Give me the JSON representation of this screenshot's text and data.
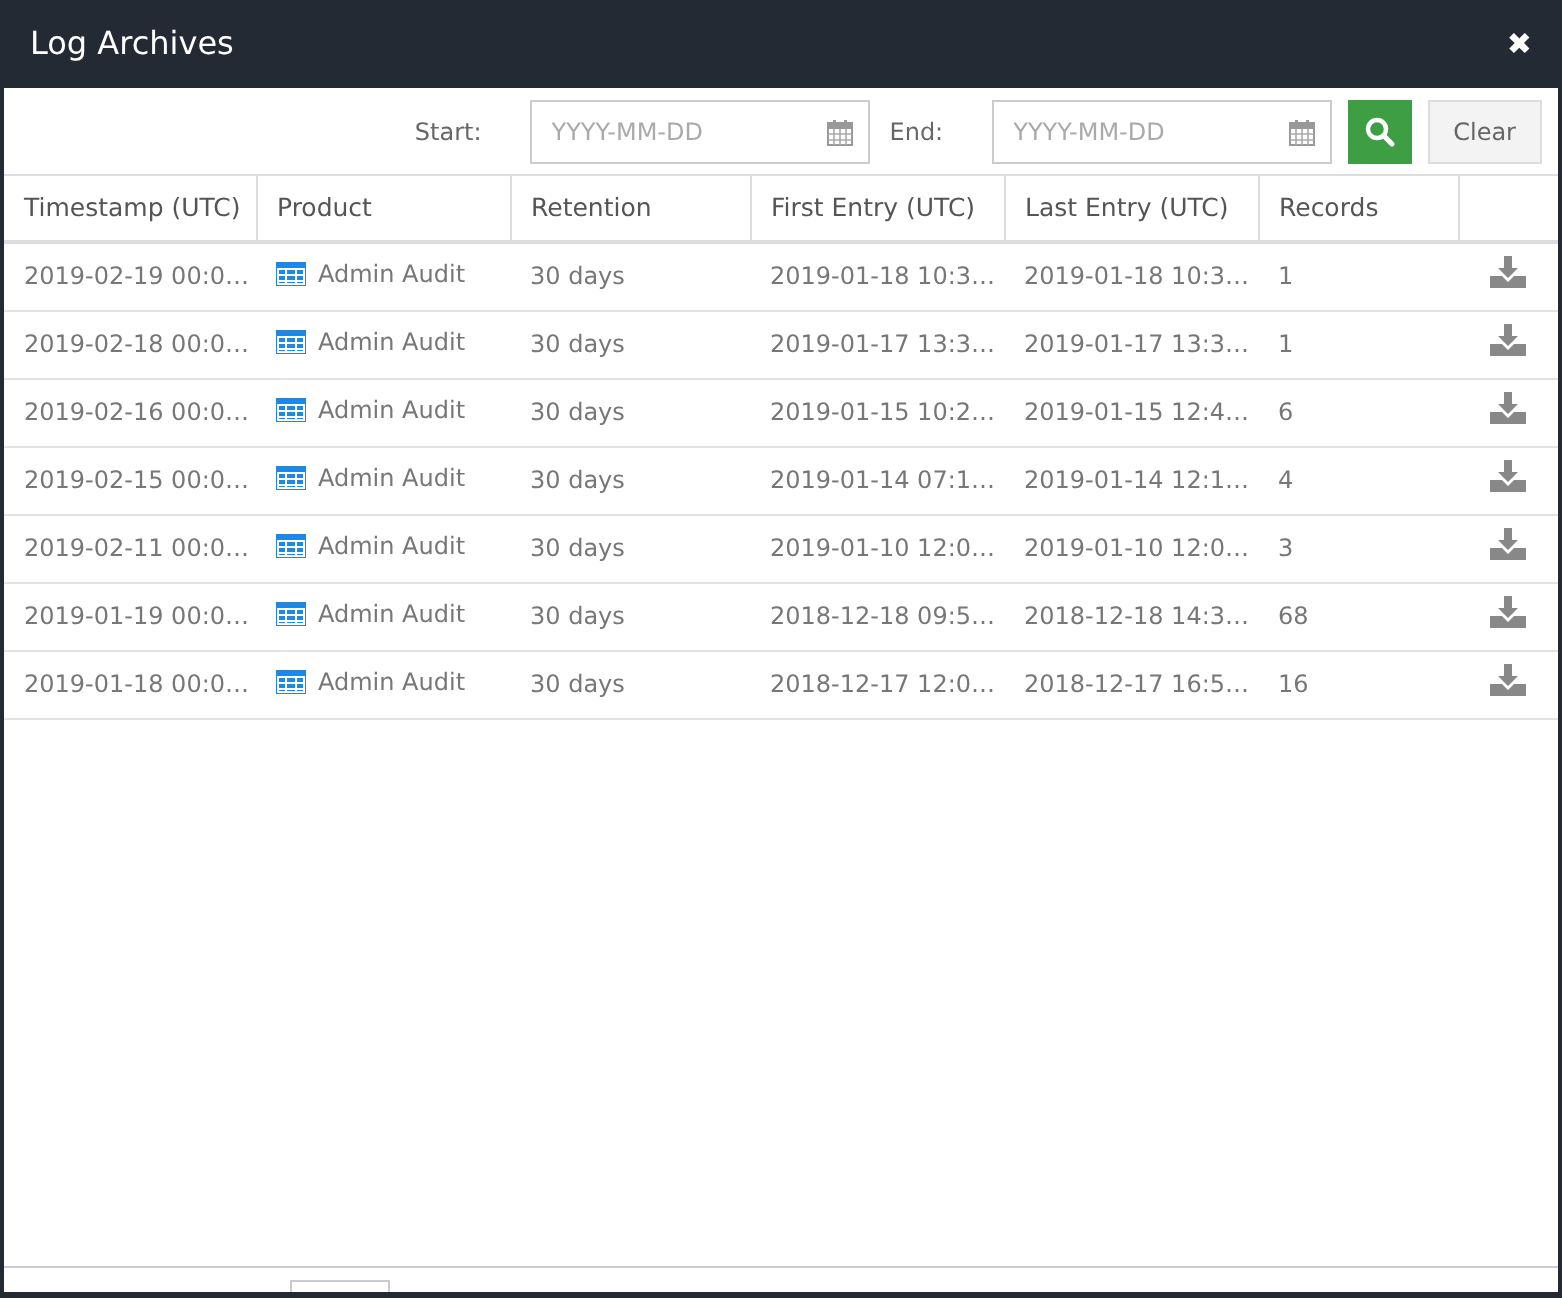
{
  "window": {
    "title": "Log Archives",
    "close": "✖"
  },
  "filter": {
    "start_label": "Start:",
    "start_placeholder": "YYYY-MM-DD",
    "end_label": "End:",
    "end_placeholder": "YYYY-MM-DD",
    "clear": "Clear"
  },
  "table": {
    "columns": [
      "Timestamp (UTC)",
      "Product",
      "Retention",
      "First Entry (UTC)",
      "Last Entry (UTC)",
      "Records"
    ],
    "rows": [
      {
        "timestamp": "2019-02-19 00:0…",
        "product": "Admin Audit",
        "retention": "30 days",
        "first": "2019-01-18 10:3…",
        "last": "2019-01-18 10:3…",
        "records": "1"
      },
      {
        "timestamp": "2019-02-18 00:0…",
        "product": "Admin Audit",
        "retention": "30 days",
        "first": "2019-01-17 13:3…",
        "last": "2019-01-17 13:3…",
        "records": "1"
      },
      {
        "timestamp": "2019-02-16 00:0…",
        "product": "Admin Audit",
        "retention": "30 days",
        "first": "2019-01-15 10:2…",
        "last": "2019-01-15 12:4…",
        "records": "6"
      },
      {
        "timestamp": "2019-02-15 00:0…",
        "product": "Admin Audit",
        "retention": "30 days",
        "first": "2019-01-14 07:1…",
        "last": "2019-01-14 12:1…",
        "records": "4"
      },
      {
        "timestamp": "2019-02-11 00:0…",
        "product": "Admin Audit",
        "retention": "30 days",
        "first": "2019-01-10 12:0…",
        "last": "2019-01-10 12:0…",
        "records": "3"
      },
      {
        "timestamp": "2019-01-19 00:0…",
        "product": "Admin Audit",
        "retention": "30 days",
        "first": "2018-12-18 09:5…",
        "last": "2018-12-18 14:3…",
        "records": "68"
      },
      {
        "timestamp": "2019-01-18 00:0…",
        "product": "Admin Audit",
        "retention": "30 days",
        "first": "2018-12-17 12:0…",
        "last": "2018-12-17 16:5…",
        "records": "16"
      }
    ]
  }
}
